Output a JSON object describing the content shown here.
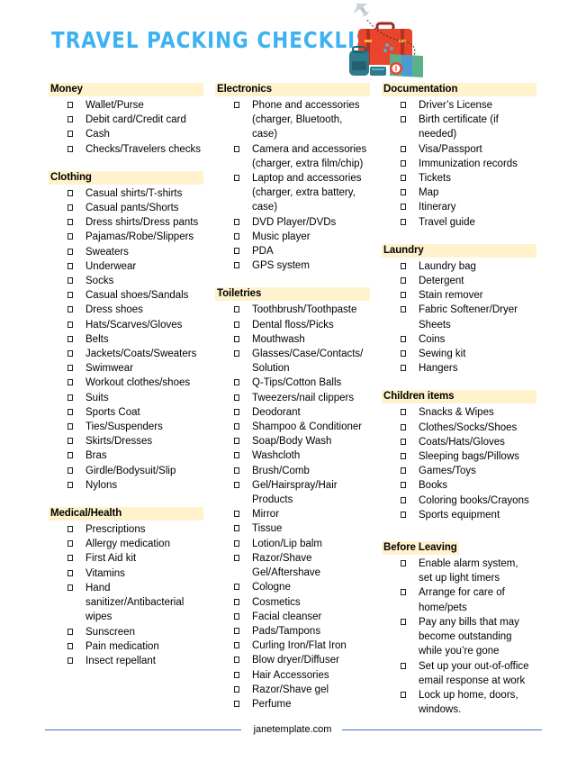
{
  "title": "TRAVEL PACKING CHECKLIST",
  "colors": {
    "title": "#3DB2F0",
    "section_header_bg": "#FFF2CC",
    "footer_line": "#4472C4"
  },
  "hero_icon": "suitcase-travel-illustration",
  "checkbox_icon": "empty-checkbox",
  "columns": [
    {
      "sections": [
        {
          "name": "Money",
          "items": [
            "Wallet/Purse",
            "Debit card/Credit card",
            "Cash",
            "Checks/Travelers checks"
          ]
        },
        {
          "name": "Clothing",
          "items": [
            "Casual shirts/T-shirts",
            "Casual pants/Shorts",
            "Dress shirts/Dress pants",
            "Pajamas/Robe/Slippers",
            "Sweaters",
            "Underwear",
            "Socks",
            "Casual shoes/Sandals",
            "Dress shoes",
            "Hats/Scarves/Gloves",
            "Belts",
            "Jackets/Coats/Sweaters",
            "Swimwear",
            "Workout clothes/shoes",
            "Suits",
            "Sports Coat",
            "Ties/Suspenders",
            "Skirts/Dresses",
            "Bras",
            "Girdle/Bodysuit/Slip",
            "Nylons"
          ]
        },
        {
          "name": "Medical/Health",
          "items": [
            "Prescriptions",
            "Allergy medication",
            "First Aid kit",
            "Vitamins",
            "Hand sanitizer/Antibacterial wipes",
            "Sunscreen",
            "Pain medication",
            "Insect repellant"
          ]
        }
      ]
    },
    {
      "sections": [
        {
          "name": "Electronics",
          "items": [
            "Phone and accessories (charger, Bluetooth, case)",
            "Camera and accessories (charger, extra film/chip)",
            "Laptop and accessories (charger, extra battery, case)",
            "DVD Player/DVDs",
            "Music player",
            "PDA",
            "GPS system"
          ]
        },
        {
          "name": "Toiletries",
          "items": [
            "Toothbrush/Toothpaste",
            "Dental floss/Picks",
            "Mouthwash",
            "Glasses/Case/Contacts/Solution",
            "Q-Tips/Cotton Balls",
            "Tweezers/nail clippers",
            "Deodorant",
            "Shampoo & Conditioner",
            "Soap/Body Wash",
            "Washcloth",
            "Brush/Comb",
            "Gel/Hairspray/Hair Products",
            "Mirror",
            "Tissue",
            "Lotion/Lip balm",
            "Razor/Shave Gel/Aftershave",
            "Cologne",
            "Cosmetics",
            "Facial cleanser",
            "Pads/Tampons",
            "Curling Iron/Flat Iron",
            "Blow dryer/Diffuser",
            "Hair Accessories",
            "Razor/Shave gel",
            "Perfume"
          ]
        }
      ]
    },
    {
      "sections": [
        {
          "name": "Documentation",
          "items": [
            "Driver’s License",
            "Birth certificate (if needed)",
            "Visa/Passport",
            "Immunization records",
            "Tickets",
            "Map",
            "Itinerary",
            "Travel guide"
          ]
        },
        {
          "name": "Laundry",
          "items": [
            "Laundry bag",
            "Detergent",
            "Stain remover",
            "Fabric Softener/Dryer Sheets",
            "Coins",
            "Sewing kit",
            "Hangers"
          ]
        },
        {
          "name": "Children items",
          "items": [
            "Snacks & Wipes",
            "Clothes/Socks/Shoes",
            "Coats/Hats/Gloves",
            "Sleeping bags/Pillows",
            "Games/Toys",
            "Books",
            "Coloring books/Crayons",
            "Sports equipment"
          ]
        },
        {
          "name": "Before Leaving",
          "items": [
            "Enable alarm system, set up light timers",
            "Arrange for care of home/pets",
            "Pay any bills that may become outstanding while you’re gone",
            "Set up your out-of-office email response at work",
            "Lock up home, doors, windows."
          ]
        }
      ]
    }
  ],
  "footer": {
    "text": "janetemplate.com"
  }
}
